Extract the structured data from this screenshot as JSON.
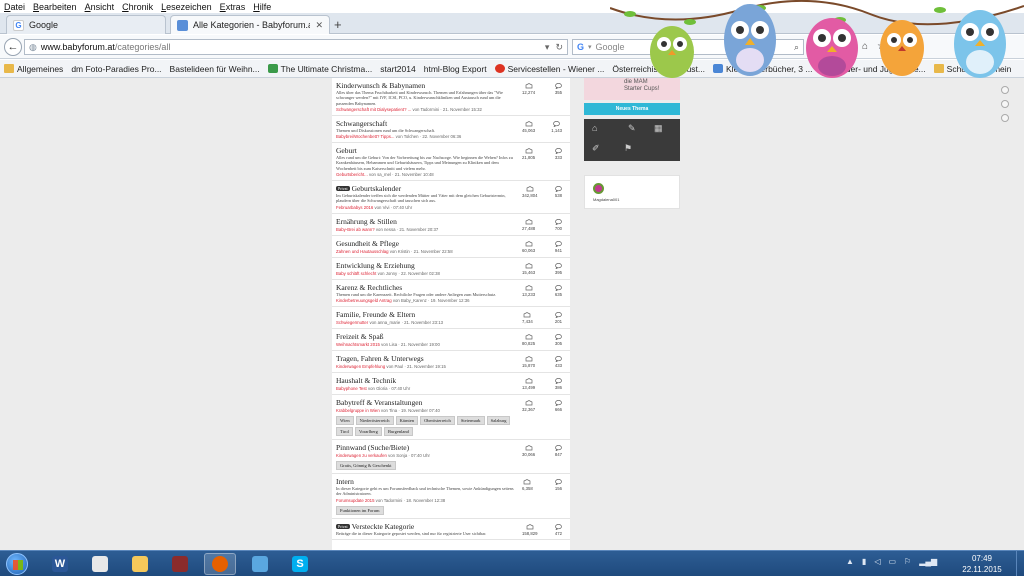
{
  "menu": [
    "Datei",
    "Bearbeiten",
    "Ansicht",
    "Chronik",
    "Lesezeichen",
    "Extras",
    "Hilfe"
  ],
  "tabs": [
    {
      "title": "Google",
      "favicon_color": "#4285f4",
      "active": false
    },
    {
      "title": "Alle Kategorien - Babyforum.at",
      "favicon_color": "#5a8fd8",
      "active": true
    }
  ],
  "newtab_symbol": "+",
  "navbar": {
    "url_host": "www.babyforum.at",
    "url_path": "/categories/all",
    "search_placeholder": "Google"
  },
  "bookmarks": [
    {
      "label": "Allgemeines",
      "icon": "folder"
    },
    {
      "label": "dm Foto-Paradies Pro...",
      "icon": "page"
    },
    {
      "label": "Bastelideen für Weihn...",
      "icon": "page"
    },
    {
      "label": "The Ultimate Christma...",
      "icon": "green"
    },
    {
      "label": "start2014",
      "icon": "page"
    },
    {
      "label": "html-Blog Export",
      "icon": "page"
    },
    {
      "label": "Servicestellen - Wiener ...",
      "icon": "red"
    },
    {
      "label": "Österreichisches Brust...",
      "icon": "page"
    },
    {
      "label": "Kleinkinderbücher, 3 ...",
      "icon": "blue"
    },
    {
      "label": "Kinder- und Jugendlite...",
      "icon": "folder"
    },
    {
      "label": "Schule allgemein",
      "icon": "folder"
    }
  ],
  "categories": [
    {
      "title": "Kinderwunsch & Babynamen",
      "desc": "Alles über das Thema Fruchtbarkeit und Kinderwunsch. Themen und Erfahrungen über das \"Wie schwanger werden?\" mit IVF, ICSI, PCO, u. Kinderwunschkliniken und Austausch rund um die passenden Babynamen.",
      "last": "Schwangerschaft mit Dialysepatient? ...",
      "meta": "von Tadormini · 21. November 15:32",
      "views": "12,274",
      "posts": "355"
    },
    {
      "title": "Schwangerschaft",
      "desc": "Themen und Diskussionen rund um die Schwangerschaft.",
      "last": "Babybrei/Wochenbett? Tipps...",
      "meta": "von Tolchen · 22. November 06:36",
      "views": "45,063",
      "posts": "1,143"
    },
    {
      "title": "Geburt",
      "desc": "Alles rund um die Geburt: Von der Vorbereitung bis zur Nachsorge. Wie beginnen die Wehen? Infos zu Krankenhäusern, Hebammen und Geburtshäusern, Tipps und Meinungen zu Kliniken und dem Wochenbett bis zum Kaiserschnitt und vielem mehr.",
      "last": "Geburtsbericht...",
      "meta": "von sa_mel · 21. November 10:48",
      "views": "21,805",
      "posts": "333"
    },
    {
      "title": "Geburtskalender",
      "badge": "Privat",
      "desc": "Im Geburtskalender treffen sich die werdenden Mütter und Väter mit dem gleichen Geburtstermin, plaudern über die Schwangerschaft und tauschen sich aus.",
      "last": "Februarbabys 2016",
      "meta": "von Vivi · 07:40 Uhr",
      "views": "342,804",
      "posts": "538"
    },
    {
      "title": "Ernährung & Stillen",
      "desc": "",
      "last": "Baby-Brei ab wann?",
      "meta": "von nessa · 21. November 20:37",
      "views": "27,488",
      "posts": "700"
    },
    {
      "title": "Gesundheit & Pflege",
      "desc": "",
      "last": "Zahnen und Hautausschlag",
      "meta": "von Kristin · 21. November 22:58",
      "views": "60,063",
      "posts": "941"
    },
    {
      "title": "Entwicklung & Erziehung",
      "desc": "",
      "last": "Baby schläft schlecht",
      "meta": "von Jonny · 22. November 02:38",
      "views": "15,463",
      "posts": "395"
    },
    {
      "title": "Karenz & Rechtliches",
      "desc": "Themen rund um die Karenzzeit. Rechtliche Fragen oder andere Anliegen zum Mutterschutz.",
      "last": "Kinderbetreuungsgeld Antrag",
      "meta": "von Baby_Karenz · 19. November 12:36",
      "views": "13,233",
      "posts": "635"
    },
    {
      "title": "Familie, Freunde & Eltern",
      "desc": "",
      "last": "Schwiegermutter",
      "meta": "von anna_marie · 21. November 23:13",
      "views": "7,434",
      "posts": "201"
    },
    {
      "title": "Freizeit & Spaß",
      "desc": "",
      "last": "Weihnachtsmarkt 2015",
      "meta": "von Lisa · 21. November 19:00",
      "views": "80,825",
      "posts": "305"
    },
    {
      "title": "Tragen, Fahren & Unterwegs",
      "desc": "",
      "last": "Kinderwagen Empfehlung",
      "meta": "von Paul · 21. November 19:15",
      "views": "15,870",
      "posts": "433"
    },
    {
      "title": "Haushalt & Technik",
      "desc": "",
      "last": "Babyphone Test",
      "meta": "von Gloria · 07:40 Uhr",
      "views": "13,499",
      "posts": "386"
    },
    {
      "title": "Babytreff & Veranstaltungen",
      "desc": "",
      "last": "Krabbelgruppe in Wien",
      "meta": "von Tina · 19. November 07:40",
      "views": "32,367",
      "posts": "666",
      "tags": [
        "Wien",
        "Niederösterreich",
        "Kärnten",
        "Oberösterreich",
        "Steiermark",
        "Salzburg",
        "Tirol",
        "Vorarlberg",
        "Burgenland"
      ]
    },
    {
      "title": "Pinnwand (Suche/Biete)",
      "desc": "",
      "last": "Kinderwagen zu verkaufen",
      "meta": "von Sonja · 07:40 Uhr",
      "views": "30,066",
      "posts": "847",
      "tags": [
        "Gratis, Gönnig & Geschenkt"
      ]
    },
    {
      "title": "Intern",
      "desc": "In dieser Kategorie geht es um Forumsfeedback und technische Themen, sowie Ankündigungen seitens der Administratoren.",
      "last": "Forumsupdate 2015",
      "meta": "von Tadormini · 18. November 12:38",
      "views": "6,358",
      "posts": "156",
      "tags": [
        "Funktionen im Forum"
      ]
    },
    {
      "title": "Versteckte Kategorie",
      "badge": "Privat",
      "desc": "Beiträge die in dieser Kategorie gepostet werden, sind nur für registrierte User sichtbar.",
      "last": "",
      "meta": "",
      "views": "158,829",
      "posts": "472"
    }
  ],
  "sidebar": {
    "promo_text": [
      "die MAM",
      "Starter Cups!"
    ],
    "new_topic_label": "Neues Thema",
    "username": "Magdalena001"
  },
  "taskbar": {
    "apps": [
      {
        "label": "W",
        "color": "#2b5797",
        "name": "word-icon"
      },
      {
        "label": "",
        "color": "#e8e8e8",
        "name": "mail-icon"
      },
      {
        "label": "",
        "color": "#f5c85b",
        "name": "folder-icon"
      },
      {
        "label": "",
        "color": "#8b2b2b",
        "name": "game-icon"
      },
      {
        "label": "",
        "color": "#e66000",
        "name": "firefox-icon",
        "active": true
      },
      {
        "label": "",
        "color": "#5aa7e0",
        "name": "notepad-icon"
      },
      {
        "label": "S",
        "color": "#00aff0",
        "name": "skype-icon"
      }
    ],
    "time": "07:49",
    "date": "22.11.2015"
  }
}
